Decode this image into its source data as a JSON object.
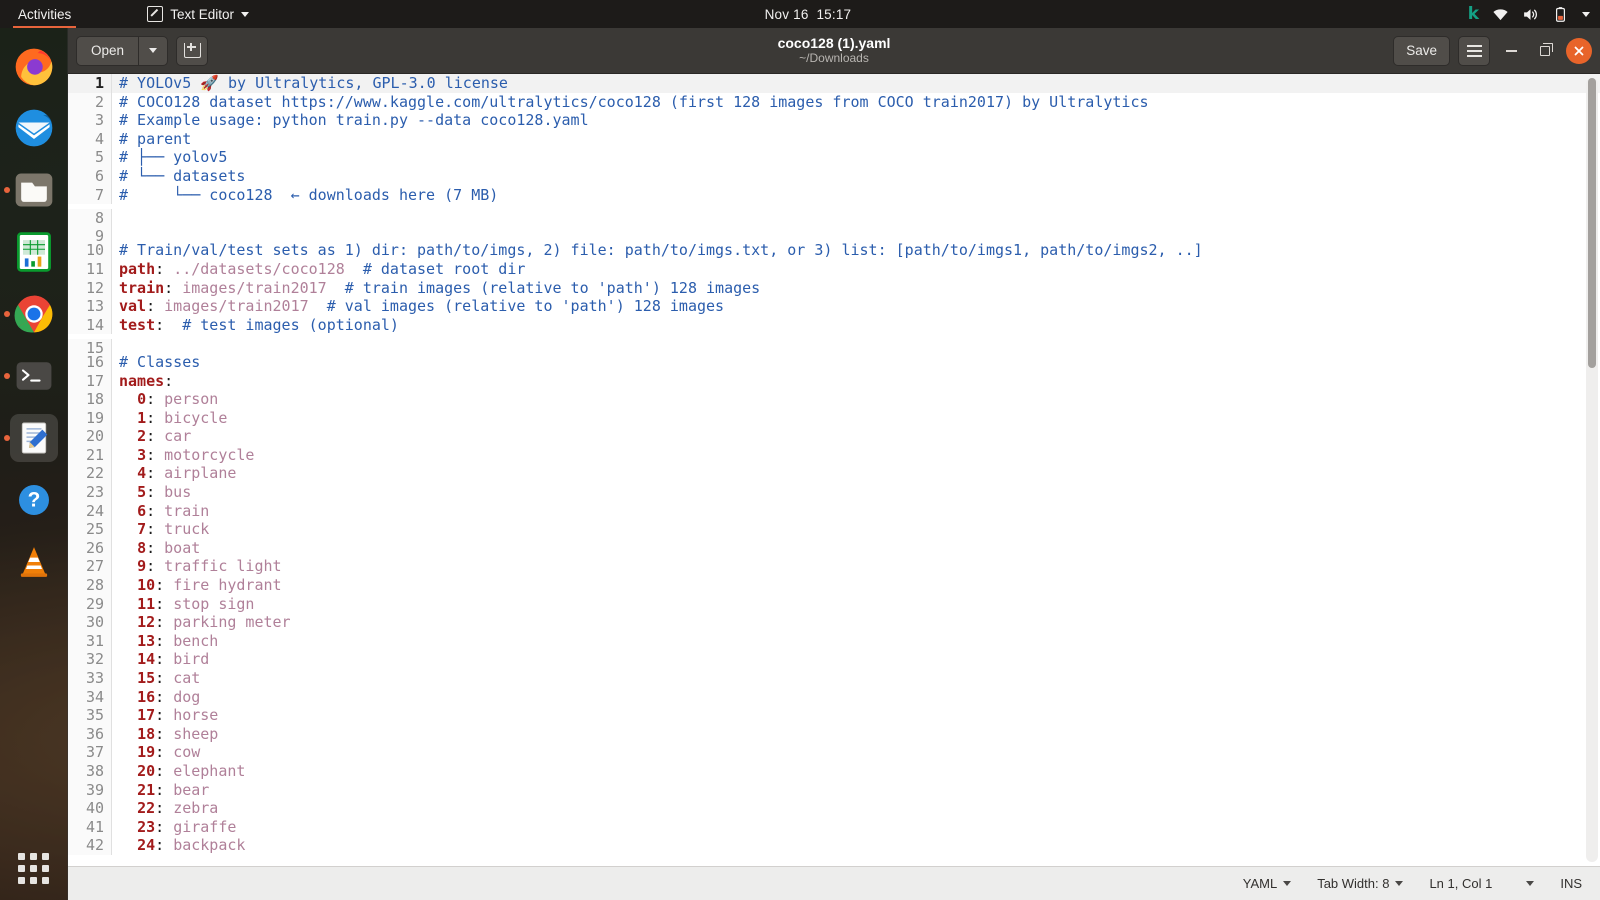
{
  "topbar": {
    "activities": "Activities",
    "app_name": "Text Editor",
    "app_icon": "text-editor-icon",
    "clock": "Nov 16  15:17",
    "indicators": [
      "k-logo",
      "wifi-icon",
      "volume-icon",
      "battery-icon",
      "system-menu-chevron-icon"
    ]
  },
  "dock": {
    "items": [
      {
        "name": "firefox",
        "label": "Firefox",
        "running": false,
        "active": false
      },
      {
        "name": "thunderbird",
        "label": "Thunderbird",
        "running": false,
        "active": false
      },
      {
        "name": "files",
        "label": "Files",
        "running": true,
        "active": false
      },
      {
        "name": "libreoffice-calc",
        "label": "LibreOffice Calc",
        "running": false,
        "active": false
      },
      {
        "name": "google-chrome",
        "label": "Google Chrome",
        "running": true,
        "active": false
      },
      {
        "name": "terminal",
        "label": "Terminal",
        "running": true,
        "active": false
      },
      {
        "name": "text-editor",
        "label": "Text Editor",
        "running": true,
        "active": true
      },
      {
        "name": "help",
        "label": "Help",
        "running": false,
        "active": false
      },
      {
        "name": "vlc",
        "label": "VLC media player",
        "running": false,
        "active": false
      }
    ],
    "show_apps_label": "Show Applications"
  },
  "window": {
    "title": "coco128 (1).yaml",
    "subtitle": "~/Downloads",
    "open_label": "Open",
    "open_dropdown_icon": "chevron-down-icon",
    "new_document_icon": "new-document-icon",
    "save_label": "Save",
    "menu_icon": "hamburger-menu-icon",
    "minimize_icon": "minimize-icon",
    "maximize_icon": "maximize-icon",
    "close_icon": "close-icon"
  },
  "statusbar": {
    "language": "YAML",
    "tab_width": "Tab Width: 8",
    "cursor_position": "Ln 1, Col 1",
    "insert_mode": "INS"
  },
  "editor": {
    "current_line": 1,
    "lines": [
      {
        "n": 1,
        "parts": [
          {
            "t": "# YOLOv5 ",
            "c": "c-com"
          },
          {
            "t": "🚀",
            "c": "emoji"
          },
          {
            "t": " by Ultralytics, GPL-3.0 license",
            "c": "c-com"
          }
        ]
      },
      {
        "n": 2,
        "parts": [
          {
            "t": "# COCO128 dataset https://www.kaggle.com/ultralytics/coco128 (first 128 images from COCO train2017) by Ultralytics",
            "c": "c-com"
          }
        ]
      },
      {
        "n": 3,
        "parts": [
          {
            "t": "# Example usage: python train.py --data coco128.yaml",
            "c": "c-com"
          }
        ]
      },
      {
        "n": 4,
        "parts": [
          {
            "t": "# parent",
            "c": "c-com"
          }
        ]
      },
      {
        "n": 5,
        "parts": [
          {
            "t": "# ├── yolov5",
            "c": "c-com"
          }
        ]
      },
      {
        "n": 6,
        "parts": [
          {
            "t": "# └── datasets",
            "c": "c-com"
          }
        ]
      },
      {
        "n": 7,
        "parts": [
          {
            "t": "#     └── coco128  ← downloads here (7 MB)",
            "c": "c-com"
          }
        ]
      },
      {
        "n": 8,
        "parts": []
      },
      {
        "n": 9,
        "parts": []
      },
      {
        "n": 10,
        "parts": [
          {
            "t": "# Train/val/test sets as 1) dir: path/to/imgs, 2) file: path/to/imgs.txt, or 3) list: [path/to/imgs1, path/to/imgs2, ..]",
            "c": "c-com"
          }
        ]
      },
      {
        "n": 11,
        "parts": [
          {
            "t": "path",
            "c": "c-key"
          },
          {
            "t": ": ",
            "c": "c-pun"
          },
          {
            "t": "../datasets/coco128",
            "c": "c-val"
          },
          {
            "t": "  ",
            "c": "c-txt"
          },
          {
            "t": "# dataset root dir",
            "c": "c-com"
          }
        ]
      },
      {
        "n": 12,
        "parts": [
          {
            "t": "train",
            "c": "c-key"
          },
          {
            "t": ": ",
            "c": "c-pun"
          },
          {
            "t": "images/train2017",
            "c": "c-val"
          },
          {
            "t": "  ",
            "c": "c-txt"
          },
          {
            "t": "# train images (relative to 'path') 128 images",
            "c": "c-com"
          }
        ]
      },
      {
        "n": 13,
        "parts": [
          {
            "t": "val",
            "c": "c-key"
          },
          {
            "t": ": ",
            "c": "c-pun"
          },
          {
            "t": "images/train2017",
            "c": "c-val"
          },
          {
            "t": "  ",
            "c": "c-txt"
          },
          {
            "t": "# val images (relative to 'path') 128 images",
            "c": "c-com"
          }
        ]
      },
      {
        "n": 14,
        "parts": [
          {
            "t": "test",
            "c": "c-key"
          },
          {
            "t": ": ",
            "c": "c-pun"
          },
          {
            "t": " # test images (optional)",
            "c": "c-com"
          }
        ]
      },
      {
        "n": 15,
        "parts": []
      },
      {
        "n": 16,
        "parts": [
          {
            "t": "# Classes",
            "c": "c-com"
          }
        ]
      },
      {
        "n": 17,
        "parts": [
          {
            "t": "names",
            "c": "c-key"
          },
          {
            "t": ":",
            "c": "c-pun"
          }
        ]
      },
      {
        "n": 18,
        "parts": [
          {
            "t": "  ",
            "c": "c-txt"
          },
          {
            "t": "0",
            "c": "c-key"
          },
          {
            "t": ": ",
            "c": "c-pun"
          },
          {
            "t": "person",
            "c": "c-val"
          }
        ]
      },
      {
        "n": 19,
        "parts": [
          {
            "t": "  ",
            "c": "c-txt"
          },
          {
            "t": "1",
            "c": "c-key"
          },
          {
            "t": ": ",
            "c": "c-pun"
          },
          {
            "t": "bicycle",
            "c": "c-val"
          }
        ]
      },
      {
        "n": 20,
        "parts": [
          {
            "t": "  ",
            "c": "c-txt"
          },
          {
            "t": "2",
            "c": "c-key"
          },
          {
            "t": ": ",
            "c": "c-pun"
          },
          {
            "t": "car",
            "c": "c-val"
          }
        ]
      },
      {
        "n": 21,
        "parts": [
          {
            "t": "  ",
            "c": "c-txt"
          },
          {
            "t": "3",
            "c": "c-key"
          },
          {
            "t": ": ",
            "c": "c-pun"
          },
          {
            "t": "motorcycle",
            "c": "c-val"
          }
        ]
      },
      {
        "n": 22,
        "parts": [
          {
            "t": "  ",
            "c": "c-txt"
          },
          {
            "t": "4",
            "c": "c-key"
          },
          {
            "t": ": ",
            "c": "c-pun"
          },
          {
            "t": "airplane",
            "c": "c-val"
          }
        ]
      },
      {
        "n": 23,
        "parts": [
          {
            "t": "  ",
            "c": "c-txt"
          },
          {
            "t": "5",
            "c": "c-key"
          },
          {
            "t": ": ",
            "c": "c-pun"
          },
          {
            "t": "bus",
            "c": "c-val"
          }
        ]
      },
      {
        "n": 24,
        "parts": [
          {
            "t": "  ",
            "c": "c-txt"
          },
          {
            "t": "6",
            "c": "c-key"
          },
          {
            "t": ": ",
            "c": "c-pun"
          },
          {
            "t": "train",
            "c": "c-val"
          }
        ]
      },
      {
        "n": 25,
        "parts": [
          {
            "t": "  ",
            "c": "c-txt"
          },
          {
            "t": "7",
            "c": "c-key"
          },
          {
            "t": ": ",
            "c": "c-pun"
          },
          {
            "t": "truck",
            "c": "c-val"
          }
        ]
      },
      {
        "n": 26,
        "parts": [
          {
            "t": "  ",
            "c": "c-txt"
          },
          {
            "t": "8",
            "c": "c-key"
          },
          {
            "t": ": ",
            "c": "c-pun"
          },
          {
            "t": "boat",
            "c": "c-val"
          }
        ]
      },
      {
        "n": 27,
        "parts": [
          {
            "t": "  ",
            "c": "c-txt"
          },
          {
            "t": "9",
            "c": "c-key"
          },
          {
            "t": ": ",
            "c": "c-pun"
          },
          {
            "t": "traffic light",
            "c": "c-val"
          }
        ]
      },
      {
        "n": 28,
        "parts": [
          {
            "t": "  ",
            "c": "c-txt"
          },
          {
            "t": "10",
            "c": "c-key"
          },
          {
            "t": ": ",
            "c": "c-pun"
          },
          {
            "t": "fire hydrant",
            "c": "c-val"
          }
        ]
      },
      {
        "n": 29,
        "parts": [
          {
            "t": "  ",
            "c": "c-txt"
          },
          {
            "t": "11",
            "c": "c-key"
          },
          {
            "t": ": ",
            "c": "c-pun"
          },
          {
            "t": "stop sign",
            "c": "c-val"
          }
        ]
      },
      {
        "n": 30,
        "parts": [
          {
            "t": "  ",
            "c": "c-txt"
          },
          {
            "t": "12",
            "c": "c-key"
          },
          {
            "t": ": ",
            "c": "c-pun"
          },
          {
            "t": "parking meter",
            "c": "c-val"
          }
        ]
      },
      {
        "n": 31,
        "parts": [
          {
            "t": "  ",
            "c": "c-txt"
          },
          {
            "t": "13",
            "c": "c-key"
          },
          {
            "t": ": ",
            "c": "c-pun"
          },
          {
            "t": "bench",
            "c": "c-val"
          }
        ]
      },
      {
        "n": 32,
        "parts": [
          {
            "t": "  ",
            "c": "c-txt"
          },
          {
            "t": "14",
            "c": "c-key"
          },
          {
            "t": ": ",
            "c": "c-pun"
          },
          {
            "t": "bird",
            "c": "c-val"
          }
        ]
      },
      {
        "n": 33,
        "parts": [
          {
            "t": "  ",
            "c": "c-txt"
          },
          {
            "t": "15",
            "c": "c-key"
          },
          {
            "t": ": ",
            "c": "c-pun"
          },
          {
            "t": "cat",
            "c": "c-val"
          }
        ]
      },
      {
        "n": 34,
        "parts": [
          {
            "t": "  ",
            "c": "c-txt"
          },
          {
            "t": "16",
            "c": "c-key"
          },
          {
            "t": ": ",
            "c": "c-pun"
          },
          {
            "t": "dog",
            "c": "c-val"
          }
        ]
      },
      {
        "n": 35,
        "parts": [
          {
            "t": "  ",
            "c": "c-txt"
          },
          {
            "t": "17",
            "c": "c-key"
          },
          {
            "t": ": ",
            "c": "c-pun"
          },
          {
            "t": "horse",
            "c": "c-val"
          }
        ]
      },
      {
        "n": 36,
        "parts": [
          {
            "t": "  ",
            "c": "c-txt"
          },
          {
            "t": "18",
            "c": "c-key"
          },
          {
            "t": ": ",
            "c": "c-pun"
          },
          {
            "t": "sheep",
            "c": "c-val"
          }
        ]
      },
      {
        "n": 37,
        "parts": [
          {
            "t": "  ",
            "c": "c-txt"
          },
          {
            "t": "19",
            "c": "c-key"
          },
          {
            "t": ": ",
            "c": "c-pun"
          },
          {
            "t": "cow",
            "c": "c-val"
          }
        ]
      },
      {
        "n": 38,
        "parts": [
          {
            "t": "  ",
            "c": "c-txt"
          },
          {
            "t": "20",
            "c": "c-key"
          },
          {
            "t": ": ",
            "c": "c-pun"
          },
          {
            "t": "elephant",
            "c": "c-val"
          }
        ]
      },
      {
        "n": 39,
        "parts": [
          {
            "t": "  ",
            "c": "c-txt"
          },
          {
            "t": "21",
            "c": "c-key"
          },
          {
            "t": ": ",
            "c": "c-pun"
          },
          {
            "t": "bear",
            "c": "c-val"
          }
        ]
      },
      {
        "n": 40,
        "parts": [
          {
            "t": "  ",
            "c": "c-txt"
          },
          {
            "t": "22",
            "c": "c-key"
          },
          {
            "t": ": ",
            "c": "c-pun"
          },
          {
            "t": "zebra",
            "c": "c-val"
          }
        ]
      },
      {
        "n": 41,
        "parts": [
          {
            "t": "  ",
            "c": "c-txt"
          },
          {
            "t": "23",
            "c": "c-key"
          },
          {
            "t": ": ",
            "c": "c-pun"
          },
          {
            "t": "giraffe",
            "c": "c-val"
          }
        ]
      },
      {
        "n": 42,
        "parts": [
          {
            "t": "  ",
            "c": "c-txt"
          },
          {
            "t": "24",
            "c": "c-key"
          },
          {
            "t": ": ",
            "c": "c-pun"
          },
          {
            "t": "backpack",
            "c": "c-val"
          }
        ]
      }
    ]
  }
}
